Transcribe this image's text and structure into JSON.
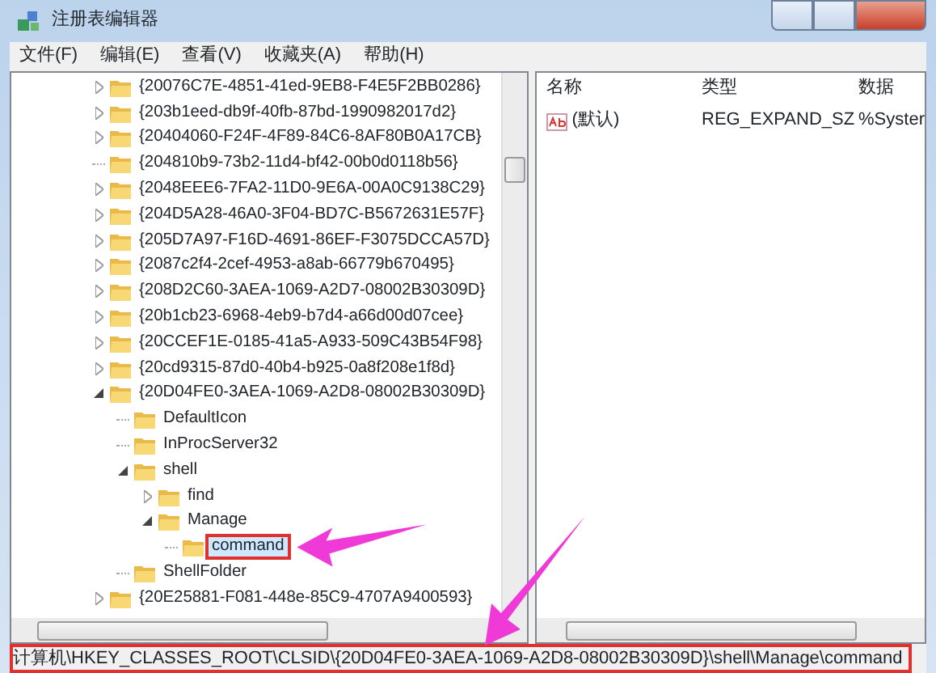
{
  "window": {
    "title": "注册表编辑器"
  },
  "menu": [
    "文件(F)",
    "编辑(E)",
    "查看(V)",
    "收藏夹(A)",
    "帮助(H)"
  ],
  "tree": [
    {
      "label": "{20076C7E-4851-41ed-9EB8-F4E5F2BB0286}",
      "kind": "folder",
      "expanded": false,
      "selected": false
    },
    {
      "label": "{203b1eed-db9f-40fb-87bd-1990982017d2}",
      "kind": "folder",
      "expanded": false,
      "selected": false
    },
    {
      "label": "{20404060-F24F-4F89-84C6-8AF80B0A17CB}",
      "kind": "folder",
      "expanded": false,
      "selected": false
    },
    {
      "label": "{204810b9-73b2-11d4-bf42-00b0d0118b56}",
      "kind": "leaf",
      "selected": false
    },
    {
      "label": "{2048EEE6-7FA2-11D0-9E6A-00A0C9138C29}",
      "kind": "folder",
      "expanded": false,
      "selected": false
    },
    {
      "label": "{204D5A28-46A0-3F04-BD7C-B5672631E57F}",
      "kind": "folder",
      "expanded": false,
      "selected": false
    },
    {
      "label": "{205D7A97-F16D-4691-86EF-F3075DCCA57D}",
      "kind": "folder",
      "expanded": false,
      "selected": false
    },
    {
      "label": "{2087c2f4-2cef-4953-a8ab-66779b670495}",
      "kind": "folder",
      "expanded": false,
      "selected": false
    },
    {
      "label": "{208D2C60-3AEA-1069-A2D7-08002B30309D}",
      "kind": "folder",
      "expanded": false,
      "selected": false
    },
    {
      "label": "{20b1cb23-6968-4eb9-b7d4-a66d00d07cee}",
      "kind": "folder",
      "expanded": false,
      "selected": false
    },
    {
      "label": "{20CCEF1E-0185-41a5-A933-509C43B54F98}",
      "kind": "folder",
      "expanded": false,
      "selected": false
    },
    {
      "label": "{20cd9315-87d0-40b4-b925-0a8f208e1f8d}",
      "kind": "folder",
      "expanded": false,
      "selected": false
    },
    {
      "label": "{20D04FE0-3AEA-1069-A2D8-08002B30309D}",
      "kind": "folder",
      "expanded": true,
      "selected": false,
      "children": [
        {
          "label": "DefaultIcon",
          "kind": "leaf",
          "selected": false
        },
        {
          "label": "InProcServer32",
          "kind": "leaf",
          "selected": false
        },
        {
          "label": "shell",
          "kind": "folder",
          "expanded": true,
          "selected": false,
          "children": [
            {
              "label": "find",
              "kind": "folder",
              "expanded": false,
              "selected": false
            },
            {
              "label": "Manage",
              "kind": "folder",
              "expanded": true,
              "selected": false,
              "children": [
                {
                  "label": "command",
                  "kind": "leaf",
                  "selected": true
                }
              ]
            }
          ]
        },
        {
          "label": "ShellFolder",
          "kind": "leaf",
          "selected": false
        }
      ]
    },
    {
      "label": "{20E25881-F081-448e-85C9-4707A9400593}",
      "kind": "folder",
      "expanded": false,
      "selected": false
    }
  ],
  "values": {
    "columns": [
      "名称",
      "类型",
      "数据"
    ],
    "rows": [
      {
        "name": "(默认)",
        "type": "REG_EXPAND_SZ",
        "data": "%Syster"
      }
    ]
  },
  "status_bar": {
    "text": "计算机\\HKEY_CLASSES_ROOT\\CLSID\\{20D04FE0-3AEA-1069-A2D8-08002B30309D}\\shell\\Manage\\command"
  }
}
